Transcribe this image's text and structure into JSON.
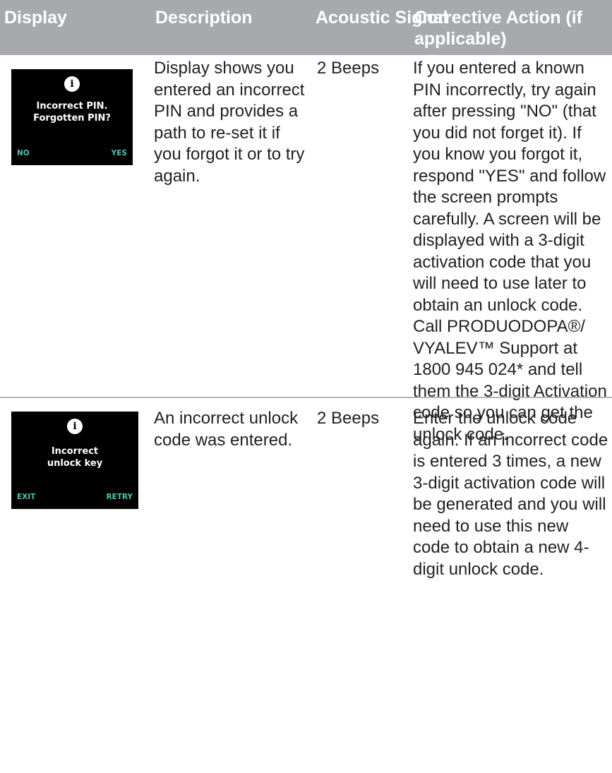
{
  "table": {
    "headers": {
      "display": "Display",
      "description": "Description",
      "signal": "Acoustic Signal",
      "action": "Corrective Action (if applicable)"
    },
    "rows": [
      {
        "screen": {
          "icon": "info-icon",
          "message": "Incorrect PIN.\nForgotten PIN?",
          "left_key": "NO",
          "right_key": "YES"
        },
        "description": "Display shows you entered an incorrect PIN and provides a path to re-set it if you forgot it or to try again.",
        "signal": "2 Beeps",
        "action": "If you entered a known PIN incorrectly, try again after pressing \"NO\" (that you did not forget it). If you know you forgot it, respond \"YES\" and follow the screen prompts carefully. A screen will be displayed with a 3-digit activation code that you will need to use later to obtain an unlock code. Call PRODUODOPA®/ VYALEV™ Support at 1800 945 024* and tell them the 3-digit Activation code so you can get the unlock code."
      },
      {
        "screen": {
          "icon": "info-icon",
          "message": "Incorrect\nunlock key",
          "left_key": "EXIT",
          "right_key": "RETRY"
        },
        "description": "An incorrect unlock code was entered.",
        "signal": "2 Beeps",
        "action": "Enter the unlock code again. If an incorrect code is entered 3 times, a new 3-digit activation code will be generated and you will need to use this new code to obtain a new 4-digit unlock code."
      }
    ]
  },
  "colors": {
    "header_bg": "#a7a9ac",
    "header_text": "#ffffff",
    "softkey": "#4fc3b0",
    "body_text": "#231f20"
  }
}
